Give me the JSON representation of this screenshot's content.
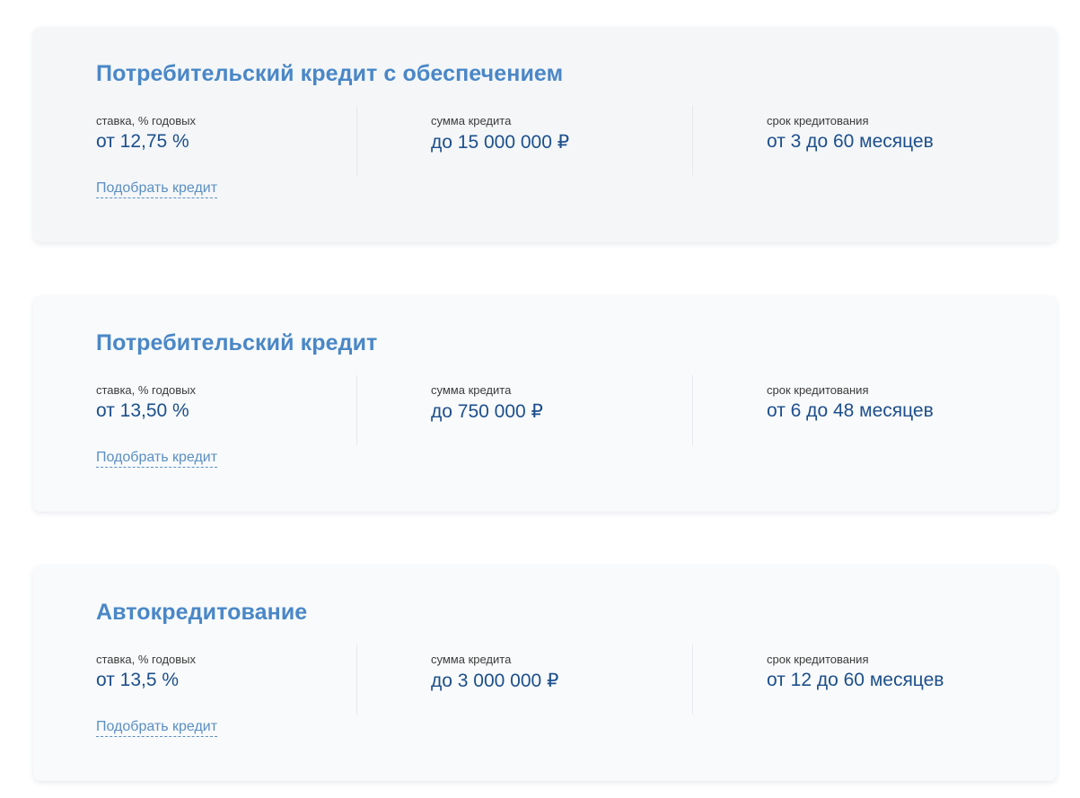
{
  "products": [
    {
      "title": "Потребительский кредит с обеспечением",
      "rate_label": "ставка, % годовых",
      "rate_value": "от 12,75 %",
      "amount_label": "сумма кредита",
      "amount_value": "до 15 000 000 ₽",
      "term_label": "срок кредитования",
      "term_value": "от 3 до 60 месяцев",
      "link_label": "Подобрать кредит"
    },
    {
      "title": "Потребительский кредит",
      "rate_label": "ставка, % годовых",
      "rate_value": "от 13,50 %",
      "amount_label": "сумма кредита",
      "amount_value": "до 750 000 ₽",
      "term_label": "срок кредитования",
      "term_value": "от 6 до 48 месяцев",
      "link_label": "Подобрать кредит"
    },
    {
      "title": "Автокредитование",
      "rate_label": "ставка, % годовых",
      "rate_value": "от 13,5 %",
      "amount_label": "сумма кредита",
      "amount_value": "до 3 000 000 ₽",
      "term_label": "срок кредитования",
      "term_value": "от 12 до 60 месяцев",
      "link_label": "Подобрать кредит"
    }
  ],
  "colors": {
    "title": "#4a87c7",
    "value": "#1d4f8c",
    "link": "#5b8fc3",
    "card_background": "#f4f6f8"
  }
}
